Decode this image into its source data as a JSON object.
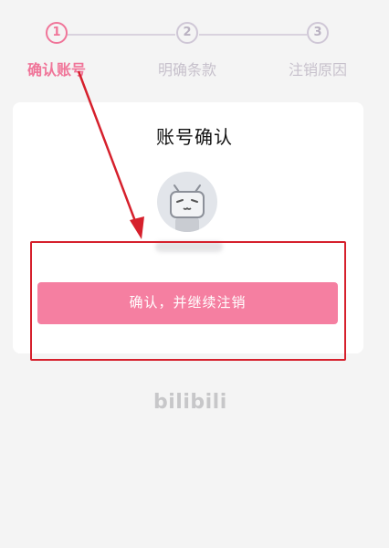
{
  "steps": [
    {
      "number": "1",
      "label": "确认账号"
    },
    {
      "number": "2",
      "label": "明确条款"
    },
    {
      "number": "3",
      "label": "注销原因"
    }
  ],
  "card": {
    "title": "账号确认",
    "avatar_icon": "bilibili-tv-mascot-icon",
    "confirm_button": "确认，并继续注销"
  },
  "footer": {
    "logo": "bilibili"
  },
  "colors": {
    "accent": "#f07599",
    "button": "#f57fa1",
    "annotation": "#d6202c"
  }
}
